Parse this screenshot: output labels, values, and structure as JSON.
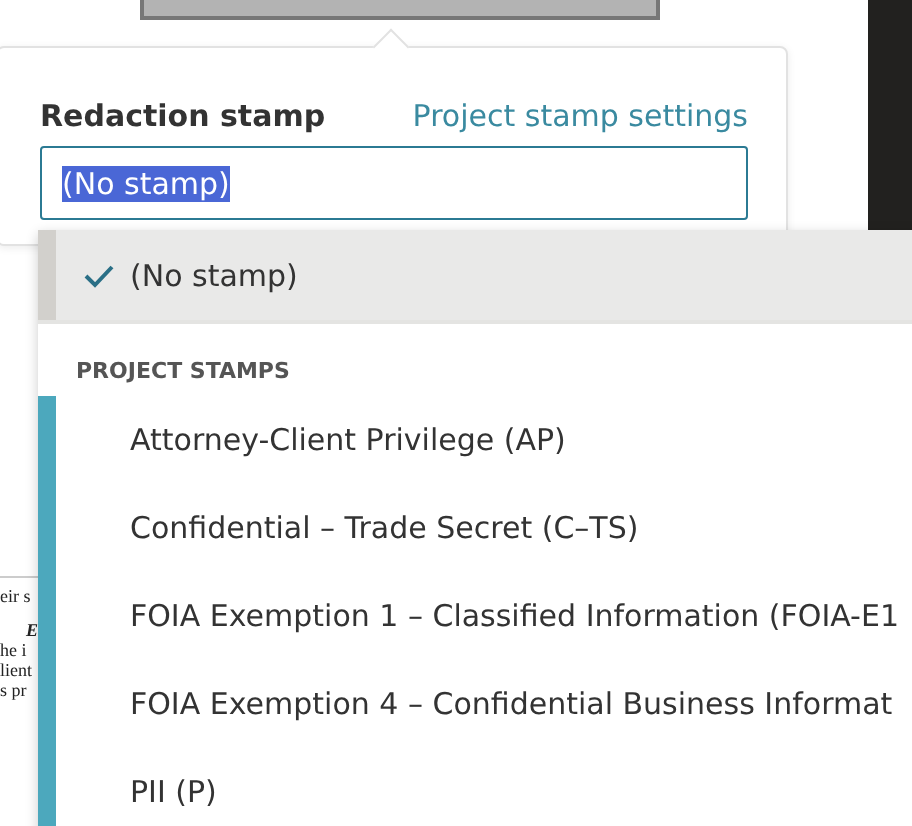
{
  "background_document": {
    "lines": [
      "eir s",
      "E",
      "he i",
      "lient",
      "s pr"
    ]
  },
  "popover": {
    "label": "Redaction stamp",
    "link": "Project stamp settings",
    "field": {
      "value": "(No stamp)",
      "text_selected": true
    }
  },
  "dropdown": {
    "options": [
      {
        "label": "(No stamp)",
        "selected": true
      }
    ],
    "groups": [
      {
        "header": "PROJECT STAMPS",
        "options": [
          {
            "label": "Attorney-Client Privilege (AP)",
            "selected": false
          },
          {
            "label": "Confidential – Trade Secret (C–TS)",
            "selected": false
          },
          {
            "label": "FOIA Exemption 1 – Classified Information (FOIA-E1",
            "selected": false
          },
          {
            "label": "FOIA Exemption 4 – Confidential Business Informat",
            "selected": false
          },
          {
            "label": "PII (P)",
            "selected": false
          }
        ]
      }
    ]
  }
}
